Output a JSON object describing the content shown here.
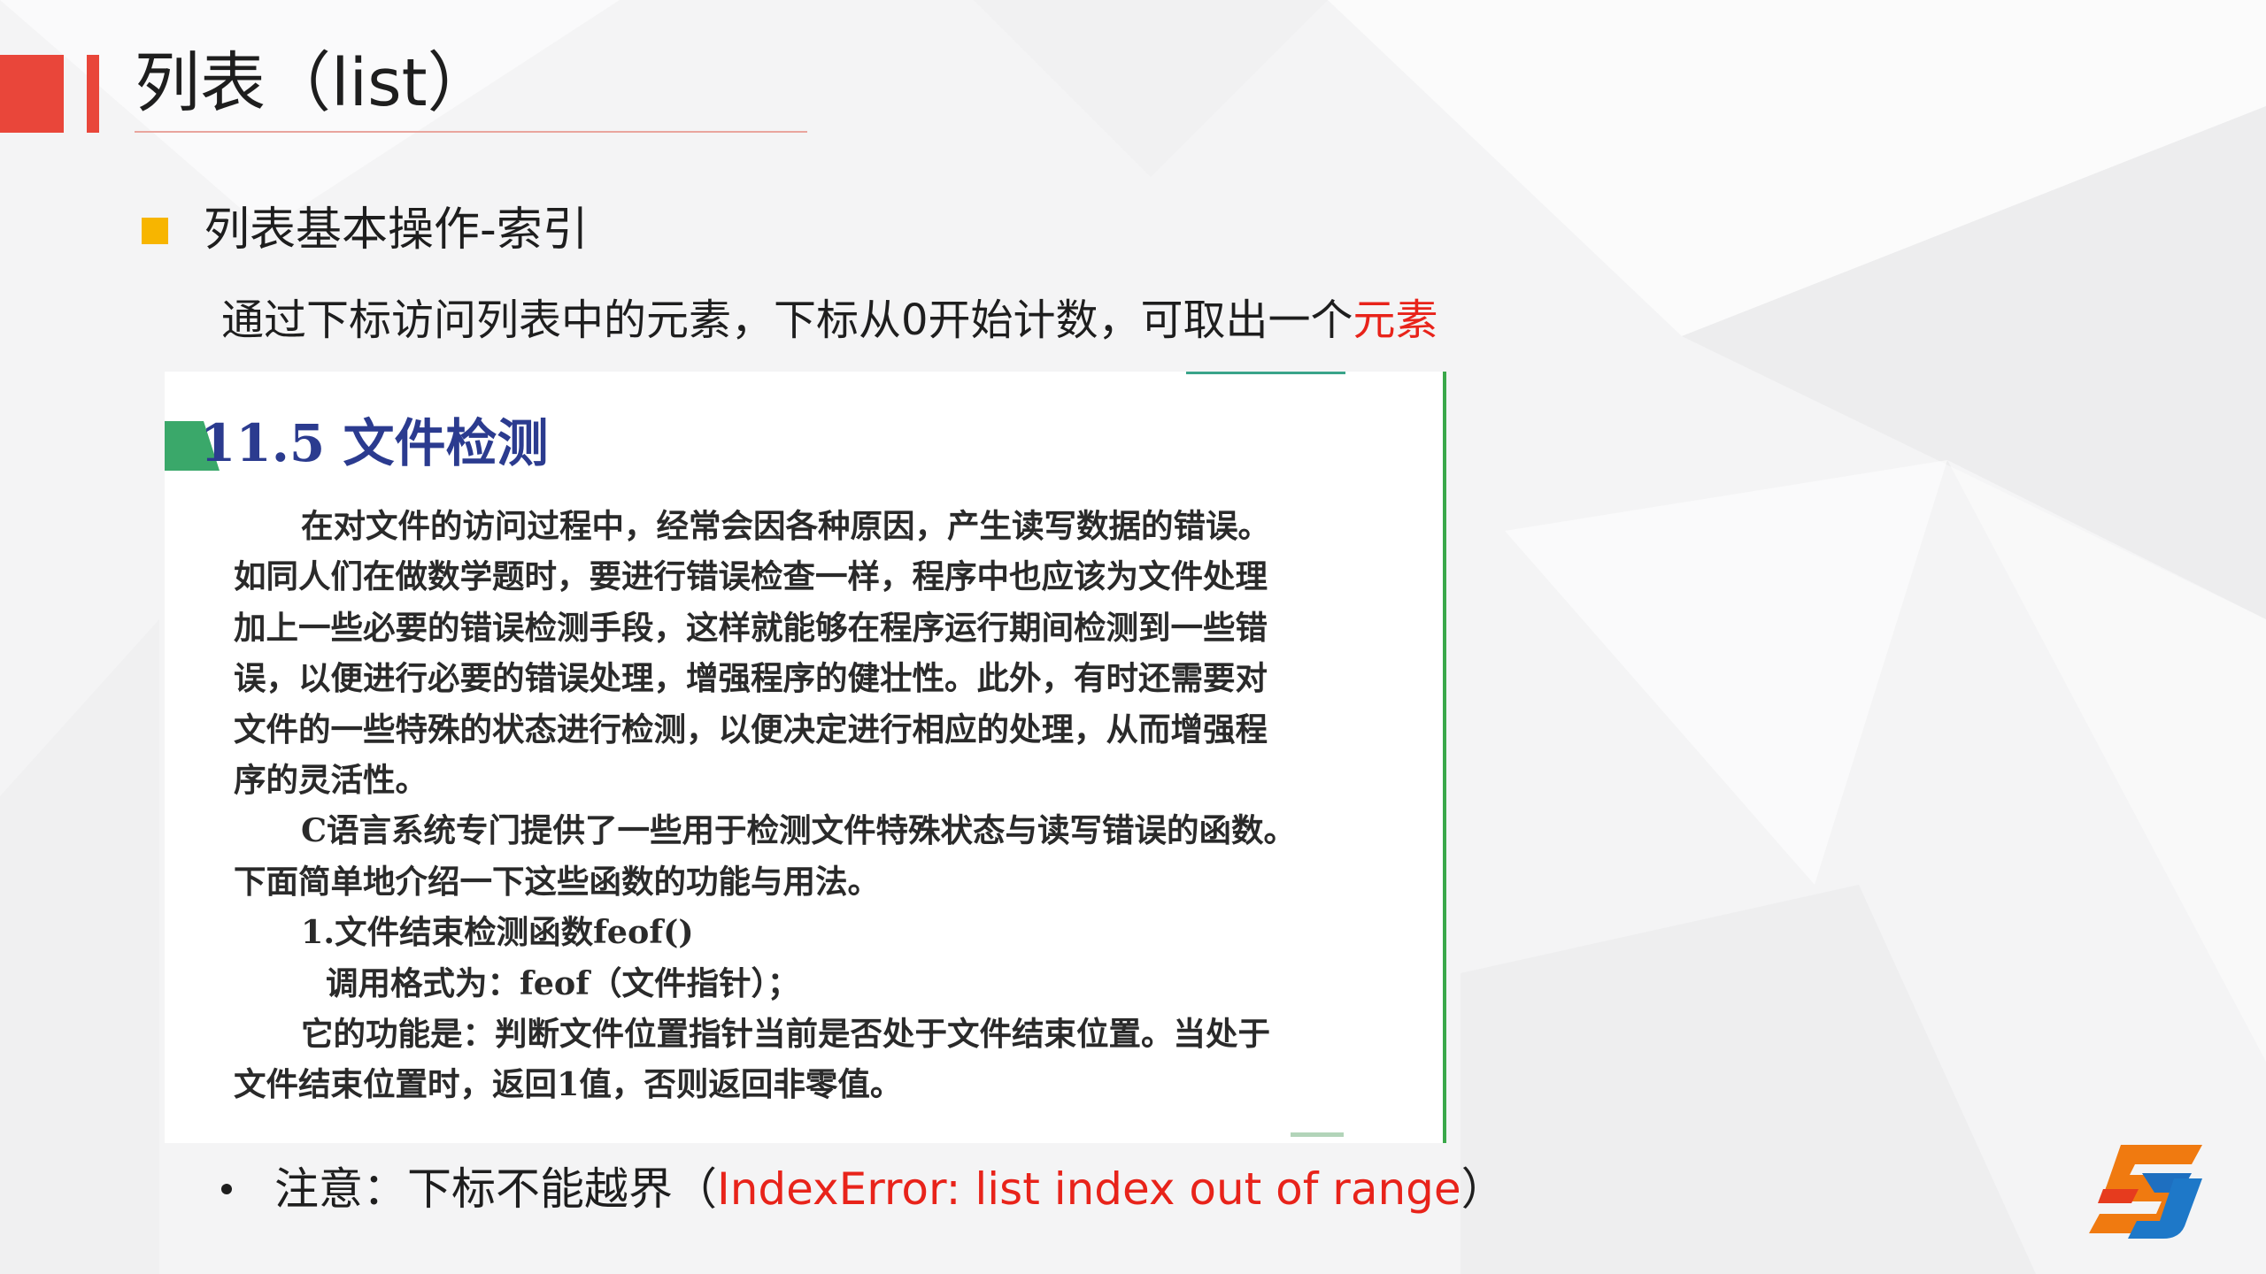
{
  "slide": {
    "title": "列表（list）",
    "section_heading": "列表基本操作-索引",
    "description_main": "通过下标访问列表中的元素，下标从0开始计数，可取出一个",
    "description_highlight": "元素",
    "note_prefix": "注意：下标不能越界（",
    "note_error": "IndexError: list index out of range",
    "note_suffix": "）"
  },
  "book_image": {
    "heading": "11.5 文件检测",
    "lines": [
      "在对文件的访问过程中，经常会因各种原因，产生读写数据的错误。",
      "如同人们在做数学题时，要进行错误检查一样，程序中也应该为文件处理",
      "加上一些必要的错误检测手段，这样就能够在程序运行期间检测到一些错",
      "误，以便进行必要的错误处理，增强程序的健壮性。此外，有时还需要对",
      "文件的一些特殊的状态进行检测，以便决定进行相应的处理，从而增强程",
      "序的灵活性。",
      "C语言系统专门提供了一些用于检测文件特殊状态与读写错误的函数。",
      "下面简单地介绍一下这些函数的功能与用法。",
      "1.文件结束检测函数feof()",
      "调用格式为：feof（文件指针）；",
      "它的功能是：判断文件位置指针当前是否处于文件结束位置。当处于",
      "文件结束位置时，返回1值，否则返回非零值。"
    ]
  },
  "colors": {
    "accent_red": "#e9463a",
    "bullet_yellow": "#f7b500",
    "highlight_red": "#e8231a",
    "book_heading_blue": "#2b3b8f",
    "book_border_green": "#3aa84a"
  },
  "icons": {
    "logo": "s-logo-icon"
  }
}
